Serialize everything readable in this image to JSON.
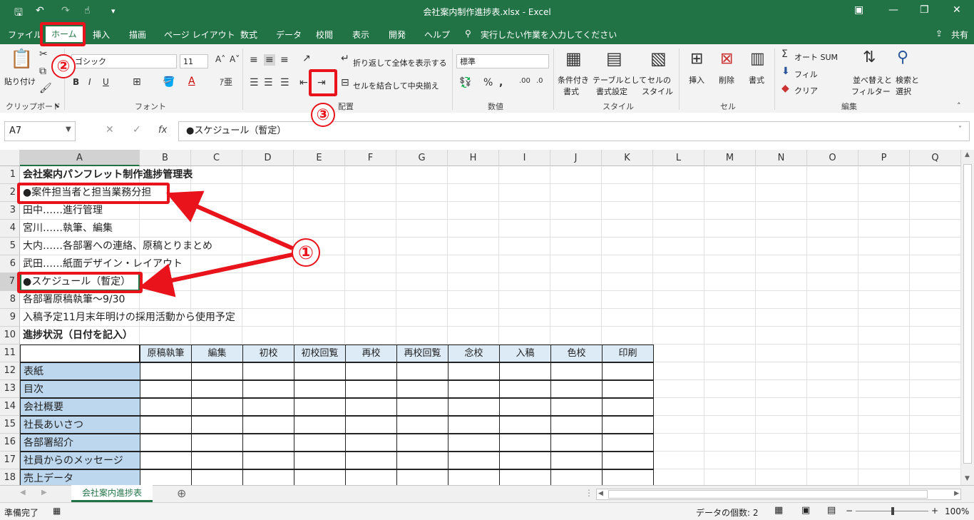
{
  "window": {
    "title": "会社案内制作進捗表.xlsx  -  Excel",
    "share_label": "共有"
  },
  "ribbon_tabs": [
    "ファイル",
    "ホーム",
    "挿入",
    "描画",
    "ページ レイアウト",
    "数式",
    "データ",
    "校閲",
    "表示",
    "開発",
    "ヘルプ"
  ],
  "tell_me": "実行したい作業を入力してください",
  "ribbon": {
    "clipboard": {
      "paste": "貼り付け",
      "group": "クリップボード"
    },
    "font": {
      "name": "ゴシック",
      "size": "11",
      "group": "フォント"
    },
    "alignment": {
      "wrap": "折り返して全体を表示する",
      "merge": "セルを結合して中央揃え",
      "group": "配置"
    },
    "number": {
      "format": "標準",
      "group": "数値"
    },
    "styles": {
      "conditional": "条件付き",
      "conditional2": "書式",
      "table": "テーブルとして",
      "table2": "書式設定",
      "cell": "セルの",
      "cell2": "スタイル",
      "group": "スタイル"
    },
    "cells": {
      "insert": "挿入",
      "delete": "削除",
      "format": "書式",
      "group": "セル"
    },
    "editing": {
      "autosum": "オート SUM",
      "fill": "フィル",
      "clear": "クリア",
      "sort": "並べ替えと",
      "sort2": "フィルター",
      "find": "検索と",
      "find2": "選択",
      "group": "編集"
    }
  },
  "formula_bar": {
    "name_box": "A7",
    "fx": "fx",
    "content": "●スケジュール（暫定）"
  },
  "columns": [
    "A",
    "B",
    "C",
    "D",
    "E",
    "F",
    "G",
    "H",
    "I",
    "J",
    "K",
    "L",
    "M",
    "N",
    "O",
    "P",
    "Q"
  ],
  "rows": [
    "1",
    "2",
    "3",
    "4",
    "5",
    "6",
    "7",
    "8",
    "9",
    "10",
    "11",
    "12",
    "13",
    "14",
    "15",
    "16",
    "17",
    "18"
  ],
  "cells": {
    "r1": "会社案内パンフレット制作進捗管理表",
    "r2": "●案件担当者と担当業務分担",
    "r3": "田中……進行管理",
    "r4": "宮川……執筆、編集",
    "r5": "大内……各部署への連絡、原稿とりまとめ",
    "r6": "武田……紙面デザイン・レイアウト",
    "r7": "●スケジュール（暫定）",
    "r8": "各部署原稿執筆～9/30",
    "r9": "入稿予定11月末年明けの採用活動から使用予定",
    "r10": "進捗状況（日付を記入）"
  },
  "table_headers": [
    "原稿執筆",
    "編集",
    "初校",
    "初校回覧",
    "再校",
    "再校回覧",
    "念校",
    "入稿",
    "色校",
    "印刷"
  ],
  "table_rows": [
    "表紙",
    "目次",
    "会社概要",
    "社長あいさつ",
    "各部署紹介",
    "社員からのメッセージ",
    "売上データ"
  ],
  "sheet_tab": "会社案内進捗表",
  "status": {
    "ready": "準備完了",
    "count": "データの個数: 2",
    "zoom": "100%"
  },
  "annotations": {
    "one": "①",
    "two": "②",
    "three": "③"
  },
  "colors": {
    "excel_green": "#217346",
    "annotation_red": "#e8131b",
    "header_fill": "#ddebf7",
    "row_label_fill": "#bdd7ee"
  }
}
